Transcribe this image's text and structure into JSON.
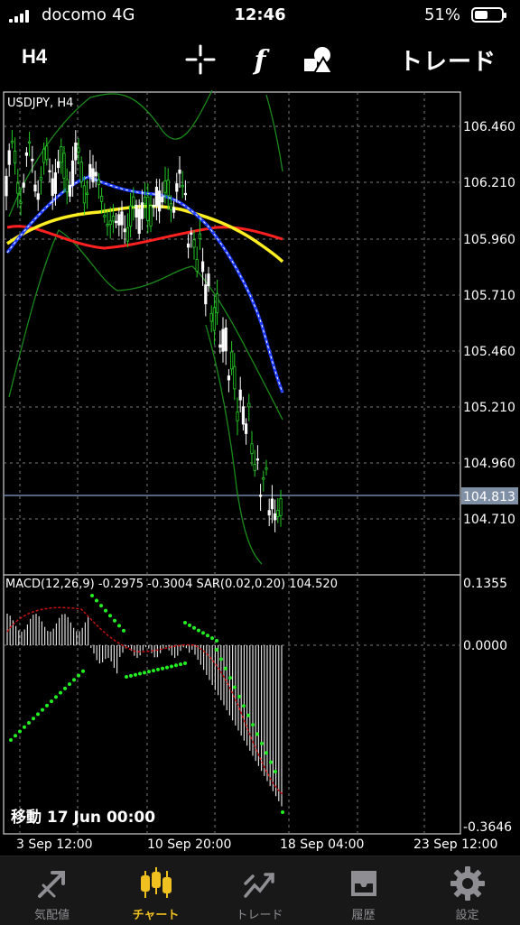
{
  "status_bar": {
    "carrier": "docomo",
    "network": "4G",
    "time": "12:46",
    "battery": "51%"
  },
  "toolbar": {
    "timeframe": "H4",
    "trade_label": "トレード",
    "icons": [
      "crosshair-icon",
      "function-icon",
      "objects-icon"
    ]
  },
  "chart": {
    "symbol_label": "USDJPY, H4",
    "price_ticks": [
      "106.460",
      "106.210",
      "105.960",
      "105.710",
      "105.460",
      "105.210",
      "104.960",
      "104.710"
    ],
    "current_price": "104.813",
    "indicator_label": "MACD(12,26,9) -0.2975 -0.3004 SAR(0.02,0.20) 104.520",
    "macd_ticks": [
      "0.1355",
      "0.0000",
      "-0.3646"
    ],
    "time_ticks": [
      "3 Sep 12:00",
      "10 Sep 20:00",
      "18 Sep 04:00",
      "23 Sep 12:00"
    ],
    "scroll_label": "移動 17 Jun 00:00",
    "colors": {
      "up_candle": "#22cc22",
      "down_candle": "#ffffff",
      "ma_fast": "#1e3cff",
      "ma_mid": "#ffee22",
      "ma_slow": "#ff2020",
      "bands": "#1a8a1a",
      "sar": "#22ee22",
      "macd_signal": "#cc1111"
    }
  },
  "tabs": [
    {
      "label": "気配値",
      "icon": "quotes-icon",
      "active": false
    },
    {
      "label": "チャート",
      "icon": "candles-icon",
      "active": true
    },
    {
      "label": "トレード",
      "icon": "trade-icon",
      "active": false
    },
    {
      "label": "履歴",
      "icon": "history-icon",
      "active": false
    },
    {
      "label": "設定",
      "icon": "settings-icon",
      "active": false
    }
  ]
}
